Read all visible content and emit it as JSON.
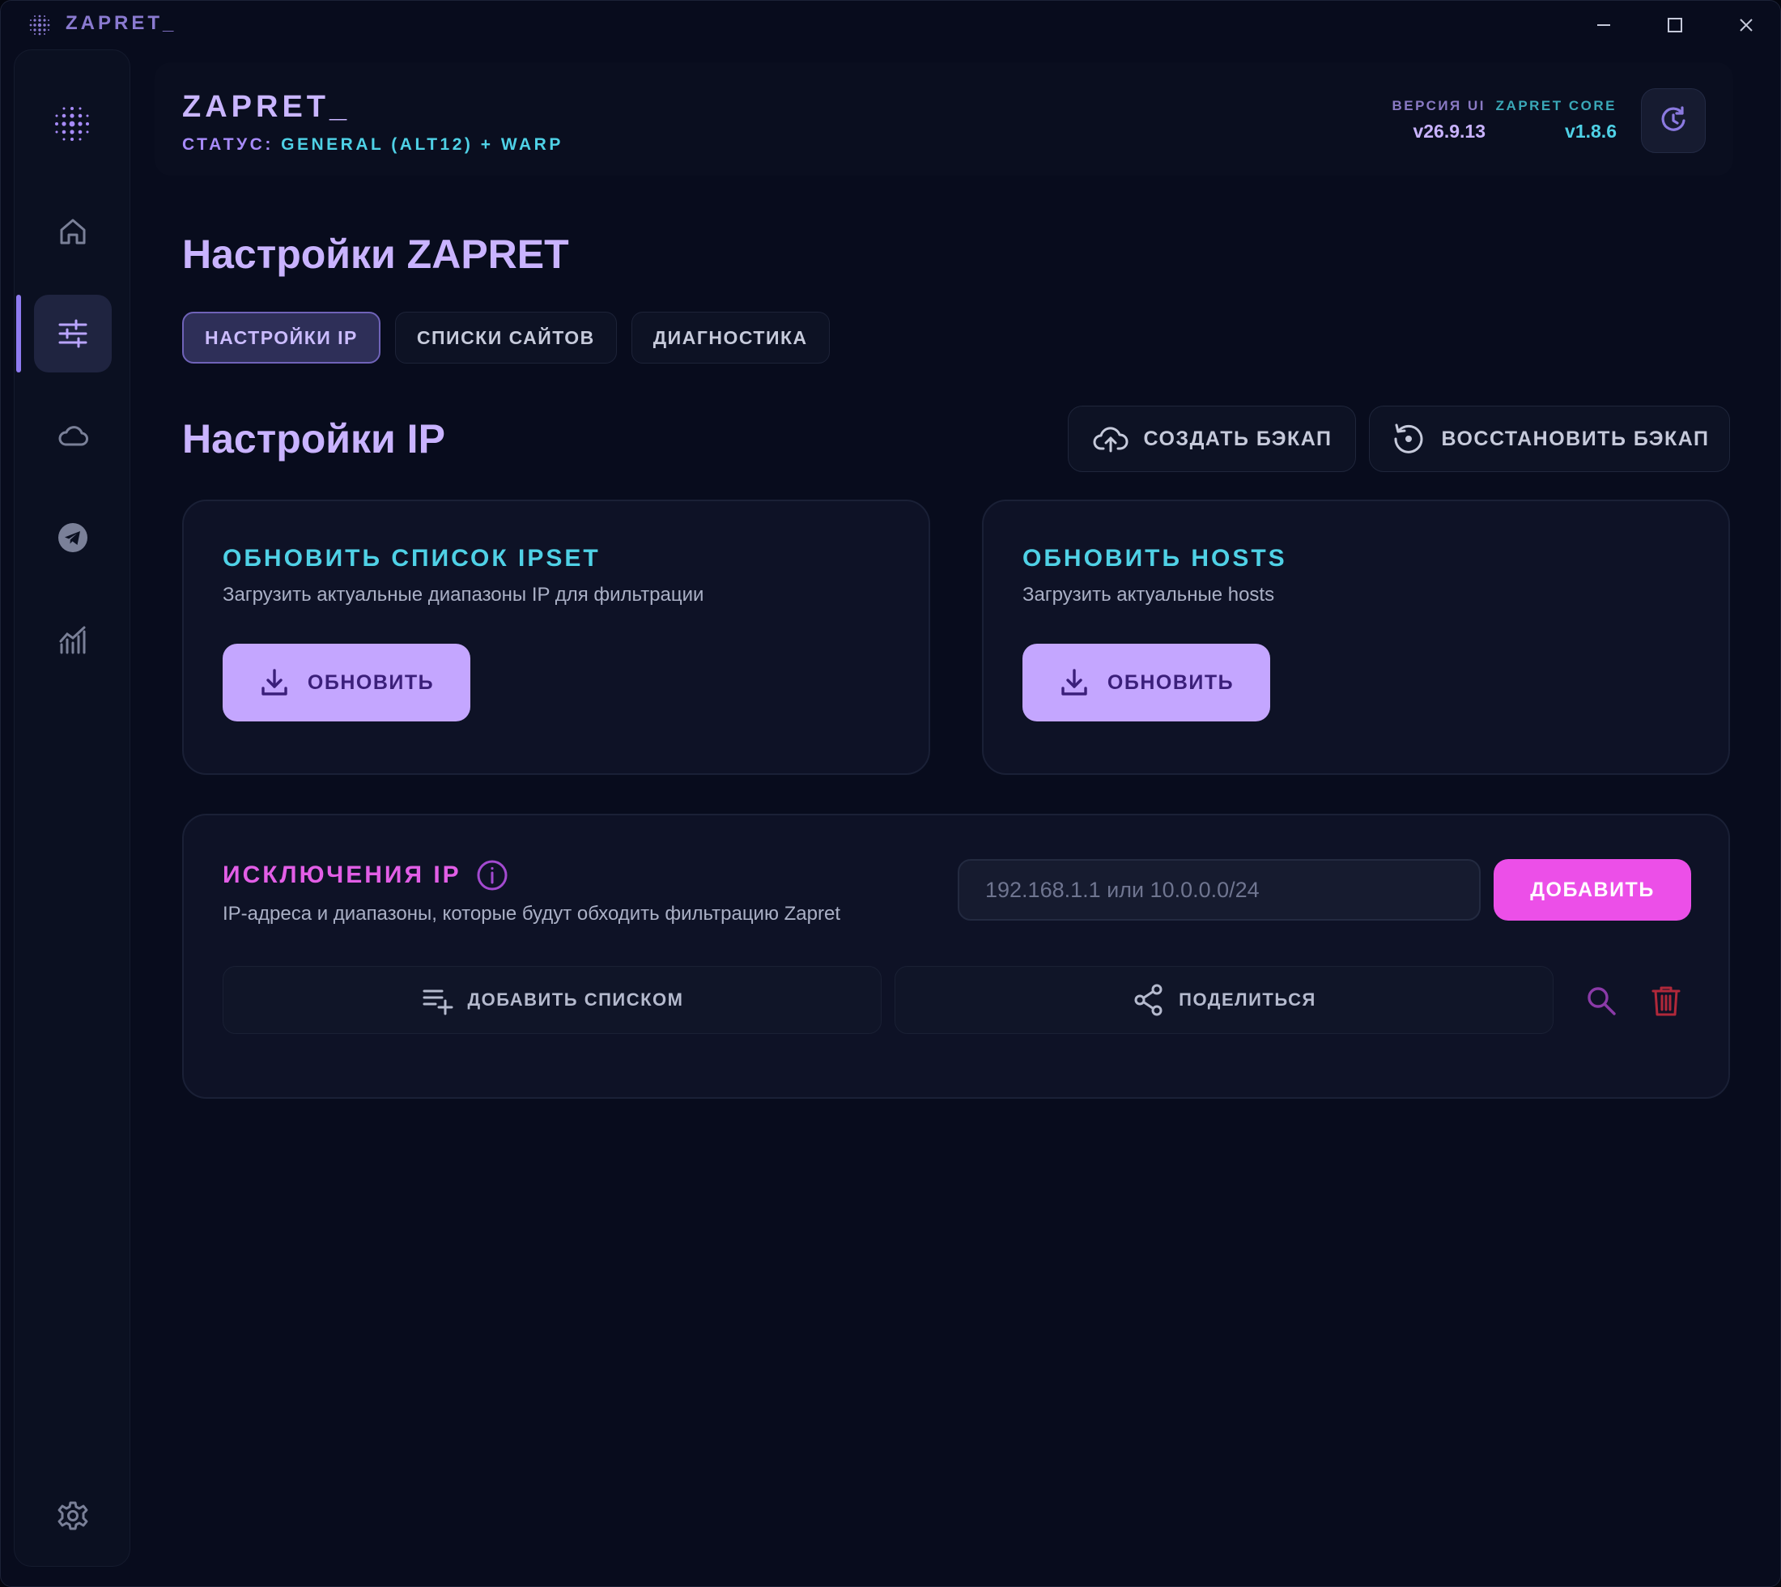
{
  "window": {
    "title": "ZAPRET_"
  },
  "header": {
    "app_title": "ZAPRET_",
    "status_label": "СТАТУС:",
    "status_value": "GENERAL (ALT12) + WARP",
    "ui_version_label": "ВЕРСИЯ UI",
    "ui_version": "v26.9.13",
    "core_version_label": "ZAPRET CORE",
    "core_version": "v1.8.6"
  },
  "sidebar": {
    "items": [
      {
        "icon": "home-icon"
      },
      {
        "icon": "sliders-icon",
        "active": true
      },
      {
        "icon": "cloud-icon"
      },
      {
        "icon": "telegram-icon"
      },
      {
        "icon": "chart-icon"
      }
    ],
    "bottom_icon": "gear-icon"
  },
  "page": {
    "title": "Настройки ZAPRET",
    "tabs": [
      {
        "label": "НАСТРОЙКИ IP",
        "active": true
      },
      {
        "label": "СПИСКИ САЙТОВ",
        "active": false
      },
      {
        "label": "ДИАГНОСТИКА",
        "active": false
      }
    ],
    "section_title": "Настройки IP",
    "backup_create": "СОЗДАТЬ БЭКАП",
    "backup_restore": "ВОССТАНОВИТЬ БЭКАП"
  },
  "cards": {
    "ipset": {
      "title": "ОБНОВИТЬ СПИСОК IPSET",
      "desc": "Загрузить актуальные диапазоны IP для фильтрации",
      "button": "ОБНОВИТЬ"
    },
    "hosts": {
      "title": "ОБНОВИТЬ HOSTS",
      "desc": "Загрузить актуальные hosts",
      "button": "ОБНОВИТЬ"
    }
  },
  "exclusions": {
    "title": "ИСКЛЮЧЕНИЯ IP",
    "desc": "IP-адреса и диапазоны, которые будут обходить фильтрацию Zapret",
    "input_value": "",
    "input_placeholder": "192.168.1.1 или 10.0.0.0/24",
    "add_button": "ДОБАВИТЬ",
    "add_list_button": "ДОБАВИТЬ СПИСКОМ",
    "share_button": "ПОДЕЛИТЬСЯ"
  },
  "colors": {
    "accent_purple": "#c4a6ff",
    "accent_cyan": "#4fd1e6",
    "accent_pink": "#ec4fe8",
    "danger": "#b0283a",
    "background": "#080c1d"
  }
}
